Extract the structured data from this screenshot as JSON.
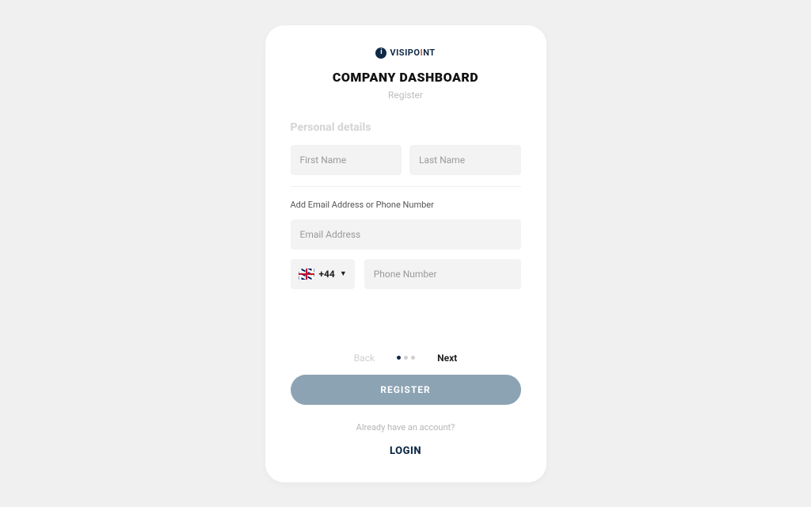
{
  "logo": {
    "brand_prefix": "VISIPO",
    "brand_accent": "I",
    "brand_suffix": "NT"
  },
  "header": {
    "title": "COMPANY DASHBOARD",
    "subtitle": "Register"
  },
  "section": {
    "label": "Personal details"
  },
  "fields": {
    "first_name_placeholder": "First Name",
    "last_name_placeholder": "Last Name",
    "contact_label": "Add Email Address or Phone Number",
    "email_placeholder": "Email Address",
    "country_code": "+44",
    "phone_placeholder": "Phone Number"
  },
  "nav": {
    "back": "Back",
    "next": "Next"
  },
  "actions": {
    "register": "REGISTER",
    "already_text": "Already have an account?",
    "login": "LOGIN"
  }
}
